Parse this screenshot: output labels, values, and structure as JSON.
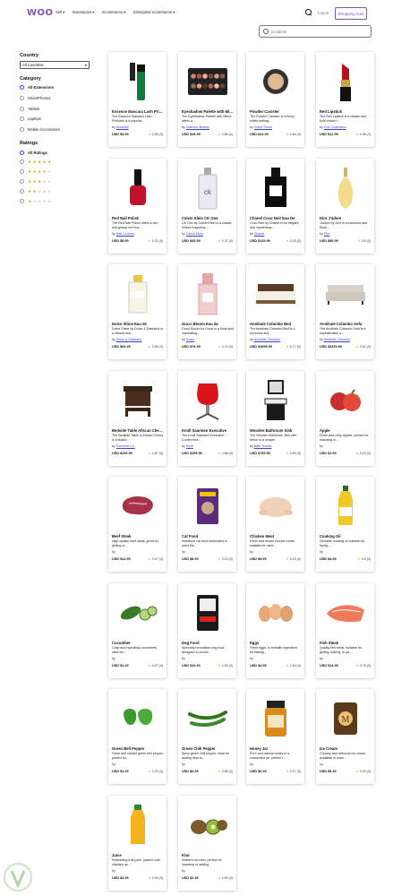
{
  "header": {
    "logo": "WOO",
    "nav": [
      "Sell",
      "Extensions",
      "Ecommerce",
      "Enterprise ecommerce"
    ],
    "login": "Log in",
    "cart": "Shopping Cart"
  },
  "search": {
    "placeholder": "products"
  },
  "sidebar": {
    "country_title": "Country",
    "country_value": "All Countries",
    "category_title": "Category",
    "categories": [
      "All Extensions",
      "SmartPhones",
      "Tablets",
      "Laptops",
      "Mobile Accessories"
    ],
    "ratings_title": "Ratings",
    "ratings_all": "All Ratings",
    "rating_levels": [
      5,
      4,
      3,
      2,
      1
    ]
  },
  "products": [
    {
      "name": "Essence Mascara Lash Princess",
      "desc": "The Essence Mascara Lash Princess is a popular...",
      "by": "Essence",
      "price": "USD $9.99",
      "old": "",
      "rating": "2.56",
      "count": "3",
      "icon": "mascara-icon"
    },
    {
      "name": "Eyeshadow Palette with Mirror",
      "desc": "The Eyeshadow Palette with Mirror offers a...",
      "by": "Glamour Beauty",
      "price": "USD $19.99",
      "old": "",
      "rating": "2.86",
      "count": "3",
      "icon": "eyeshadow-icon"
    },
    {
      "name": "Powder Canister",
      "desc": "The Powder Canister is a finely milled setting...",
      "by": "Velvet Touch",
      "price": "USD $14.99",
      "old": "",
      "rating": "4.64",
      "count": "3",
      "icon": "powder-icon"
    },
    {
      "name": "Red Lipstick",
      "desc": "The Red Lipstick is a classic and bold choice f...",
      "by": "Chic Cosmetics",
      "price": "USD $12.99",
      "old": "",
      "rating": "4.36",
      "count": "3",
      "icon": "lipstick-icon"
    },
    {
      "name": "Red Nail Polish",
      "desc": "The Red Nail Polish offers a rich and glossy red hue...",
      "by": "Nail Couture",
      "price": "USD $8.99",
      "old": "",
      "rating": "4.32",
      "count": "3",
      "icon": "nail-polish-icon"
    },
    {
      "name": "Calvin Klein CK One",
      "desc": "CK One by Calvin Klein is a classic unisex fragrance...",
      "by": "Calvin Klein",
      "price": "USD $49.99",
      "old": "",
      "rating": "4.37",
      "count": "3",
      "icon": "perfume-ck-icon"
    },
    {
      "name": "Chanel Coco Noir Eau De",
      "desc": "Coco Noir by Chanel is an elegant and mysterious...",
      "by": "Chanel",
      "price": "USD $129.99",
      "old": "",
      "rating": "4.26",
      "count": "3",
      "icon": "perfume-chanel-icon"
    },
    {
      "name": "Dior J'adore",
      "desc": "J'adore by Dior is a luxurious and floral...",
      "by": "Dior",
      "price": "USD $89.99",
      "old": "",
      "rating": "3.8",
      "count": "3",
      "icon": "perfume-dior-icon"
    },
    {
      "name": "Dolce Shine Eau de",
      "desc": "Dolce Shine by Dolce & Gabbana is a vibrant and...",
      "by": "Dolce & Gabbana",
      "price": "USD $69.99",
      "old": "",
      "rating": "3.96",
      "count": "3",
      "icon": "perfume-dolce-icon"
    },
    {
      "name": "Gucci Bloom Eau de",
      "desc": "Gucci Bloom by Gucci is a floral and captivating...",
      "by": "Gucci",
      "price": "USD $79.99",
      "old": "",
      "rating": "2.74",
      "count": "3",
      "icon": "perfume-gucci-icon"
    },
    {
      "name": "Annibale Colombo Bed",
      "desc": "The Annibale Colombo Bed is a luxurious and...",
      "by": "Annibale Colombo",
      "price": "USD $1899.99",
      "old": "",
      "rating": "4.77",
      "count": "3",
      "icon": "bed-icon"
    },
    {
      "name": "Annibale Colombo Sofa",
      "desc": "The Annibale Colombo Sofa is a sophisticated a...",
      "by": "Annibale Colombo",
      "price": "USD $2499.99",
      "old": "",
      "rating": "3.92",
      "count": "3",
      "icon": "sofa-icon"
    },
    {
      "name": "Bedside Table African Cherry",
      "desc": "The Bedside Table in African Cherry is a stylish...",
      "by": "Furniture Co.",
      "price": "USD $299.99",
      "old": "",
      "rating": "2.87",
      "count": "3",
      "icon": "bedside-table-icon"
    },
    {
      "name": "Knoll Saarinen Executive",
      "desc": "The Knoll Saarinen Executive Conference...",
      "by": "Knoll",
      "price": "USD $499.99",
      "old": "",
      "rating": "4.88",
      "count": "3",
      "icon": "chair-icon"
    },
    {
      "name": "Wooden Bathroom Sink",
      "desc": "The Wooden Bathroom Sink with Mirror is a unique...",
      "by": "Bath Trends",
      "price": "USD $799.99",
      "old": "",
      "rating": "3.59",
      "count": "3",
      "icon": "sink-icon"
    },
    {
      "name": "Apple",
      "desc": "Fresh and crisp apples, perfect for snacking or...",
      "by": "",
      "price": "USD $1.99",
      "old": "",
      "rating": "4.19",
      "count": "3",
      "icon": "apple-icon"
    },
    {
      "name": "Beef Steak",
      "desc": "High-quality beef steak, great for grilling or...",
      "by": "",
      "price": "USD $12.99",
      "old": "",
      "rating": "4.47",
      "count": "3",
      "icon": "beef-icon"
    },
    {
      "name": "Cat Food",
      "desc": "Nutritious cat food formulated to meet the...",
      "by": "",
      "price": "USD $8.99",
      "old": "",
      "rating": "3.13",
      "count": "3",
      "icon": "cat-food-icon"
    },
    {
      "name": "Chicken Meat",
      "desc": "Fresh and tender chicken meat, suitable for vario...",
      "by": "",
      "price": "USD $9.99",
      "old": "",
      "rating": "3.19",
      "count": "3",
      "icon": "chicken-icon"
    },
    {
      "name": "Cooking Oil",
      "desc": "Versatile cooking oil suitable for frying,...",
      "by": "",
      "price": "USD $4.99",
      "old": "",
      "rating": "4.8",
      "count": "3",
      "icon": "oil-icon"
    },
    {
      "name": "Cucumber",
      "desc": "Crisp and hydrating cucumbers, ideal for...",
      "by": "",
      "price": "USD $1.49",
      "old": "",
      "rating": "4.07",
      "count": "3",
      "icon": "cucumber-icon"
    },
    {
      "name": "Dog Food",
      "desc": "Specially formulated dog food designed to provid...",
      "by": "",
      "price": "USD $10.99",
      "old": "",
      "rating": "4.55",
      "count": "3",
      "icon": "dog-food-icon"
    },
    {
      "name": "Eggs",
      "desc": "Fresh eggs, a versatile ingredient for baking...",
      "by": "",
      "price": "USD $2.99",
      "old": "",
      "rating": "2.53",
      "count": "3",
      "icon": "eggs-icon"
    },
    {
      "name": "Fish Steak",
      "desc": "Quality fish steak, suitable for grilling, baking, or pa...",
      "by": "",
      "price": "USD $14.99",
      "old": "",
      "rating": "3.78",
      "count": "3",
      "icon": "fish-icon"
    },
    {
      "name": "Green Bell Pepper",
      "desc": "Fresh and vibrant green bell pepper, perfect for...",
      "by": "",
      "price": "USD $1.29",
      "old": "",
      "rating": "3.25",
      "count": "3",
      "icon": "bell-pepper-icon"
    },
    {
      "name": "Green Chili Pepper",
      "desc": "Spicy green chili pepper, ideal for adding heat to...",
      "by": "",
      "price": "USD $0.99",
      "old": "",
      "rating": "3.66",
      "count": "3",
      "icon": "chili-icon"
    },
    {
      "name": "Honey Jar",
      "desc": "Pure and natural honey in a convenient jar, perfect f...",
      "by": "",
      "price": "USD $6.99",
      "old": "",
      "rating": "3.97",
      "count": "3",
      "icon": "honey-icon"
    },
    {
      "name": "Ice Cream",
      "desc": "Creamy and delicious ice cream, available in vario...",
      "by": "",
      "price": "USD $5.49",
      "old": "",
      "rating": "3.39",
      "count": "3",
      "icon": "ice-cream-icon"
    },
    {
      "name": "Juice",
      "desc": "Refreshing fruit juice, packed with vitamins an...",
      "by": "",
      "price": "USD $3.99",
      "old": "",
      "rating": "3.94",
      "count": "3",
      "icon": "juice-icon"
    },
    {
      "name": "Kiwi",
      "desc": "Nutrient-rich kiwi, perfect for snacking or adding...",
      "by": "",
      "price": "USD $2.49",
      "old": "",
      "rating": "4.93",
      "count": "3",
      "icon": "kiwi-icon"
    }
  ],
  "labels": {
    "by_prefix": "by"
  },
  "colors": {
    "brand": "#7f54b3",
    "link": "#3b43d6",
    "star": "#e2ad00"
  }
}
